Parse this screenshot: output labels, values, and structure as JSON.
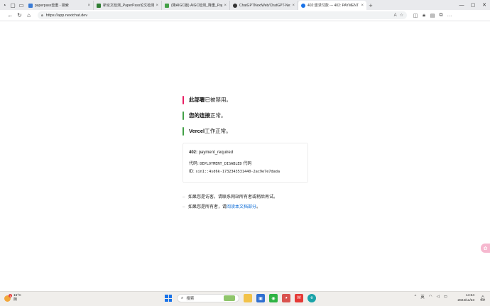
{
  "browser": {
    "tabs": [
      {
        "title": "paperpass查重 - 搜索",
        "color": "#3a7bd5"
      },
      {
        "title": "新论文检测_PaperPass论文检测",
        "color": "#2e7d32"
      },
      {
        "title": "(降AIGC版) AIGC检测_降重_Paper",
        "color": "#43a047"
      },
      {
        "title": "ChatGPTNextWeb/ChatGPT-Next",
        "color": "#333333"
      },
      {
        "title": "402:需求付款 --- 402: PAYMENT",
        "color": "#1a73e8"
      }
    ],
    "url": "https://app.nextchat.dev",
    "zoom_label": "A"
  },
  "page": {
    "status": [
      {
        "bold": "此部署",
        "text": "已被禁用。",
        "color": "#e91e63"
      },
      {
        "bold": "您的连接",
        "text": "正常。",
        "color": "#43a047"
      },
      {
        "bold": "Vercel",
        "text": "工作正常。",
        "color": "#43a047"
      }
    ],
    "error": {
      "code": "402:",
      "code_text": "payment_required",
      "code_label": "代码:",
      "code_value": "DEPLOYMENT_DISABLED",
      "code_suffix": "代码",
      "id_label": "ID:",
      "id_value": "sin1::4sd6k-1732343531440-2ac9e7e7dada"
    },
    "hints": {
      "visitor": "如果您是访客，请联系网站所有者或稍后再试。",
      "owner_prefix": "如果您是所有者，请",
      "owner_link": "阅读本文档部分",
      "owner_suffix": "。"
    }
  },
  "taskbar": {
    "weather_temp": "15°C",
    "weather_desc": "阴",
    "weather_badge": "1",
    "search_placeholder": "搜索",
    "ime": "英",
    "time": "14:34",
    "date": "2024/11/23"
  },
  "colors": {
    "link": "#0b6bd6",
    "accent_pink": "#e91e63",
    "accent_green": "#43a047"
  }
}
